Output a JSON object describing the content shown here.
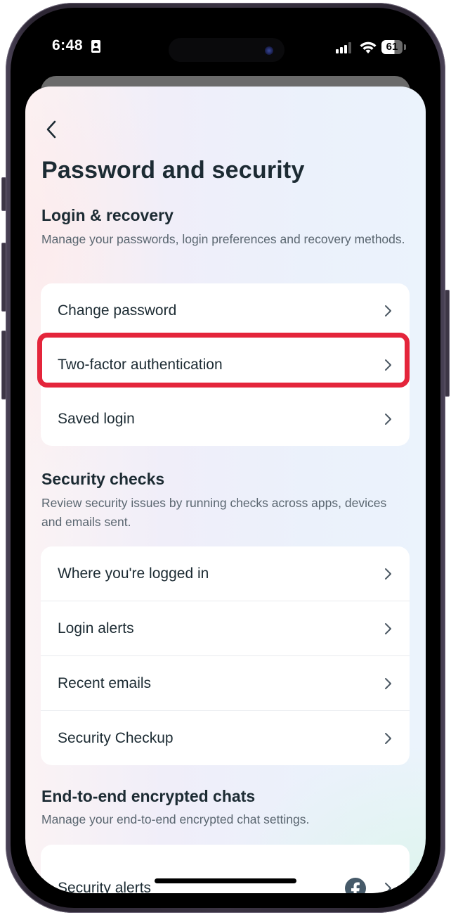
{
  "status_bar": {
    "time": "6:48",
    "battery_percent": "61",
    "icons": [
      "id-card-icon",
      "signal-icon",
      "wifi-icon",
      "battery-icon"
    ]
  },
  "header": {
    "back_icon": "chevron-left-icon",
    "title": "Password and security"
  },
  "sections": [
    {
      "title": "Login & recovery",
      "description": "Manage your passwords, login preferences and recovery methods.",
      "items": [
        {
          "label": "Change password",
          "icon": "chevron-right-icon"
        },
        {
          "label": "Two-factor authentication",
          "icon": "chevron-right-icon",
          "highlighted": true
        },
        {
          "label": "Saved login",
          "icon": "chevron-right-icon"
        }
      ]
    },
    {
      "title": "Security checks",
      "description": "Review security issues by running checks across apps, devices and emails sent.",
      "items": [
        {
          "label": "Where you're logged in",
          "icon": "chevron-right-icon"
        },
        {
          "label": "Login alerts",
          "icon": "chevron-right-icon"
        },
        {
          "label": "Recent emails",
          "icon": "chevron-right-icon"
        },
        {
          "label": "Security Checkup",
          "icon": "chevron-right-icon"
        }
      ]
    },
    {
      "title": "End-to-end encrypted chats",
      "description": "Manage your end-to-end encrypted chat settings.",
      "items": [
        {
          "label": "Security alerts",
          "icon": "chevron-right-icon",
          "badge_icon": "facebook-icon"
        }
      ]
    }
  ],
  "colors": {
    "highlight": "#e4253b",
    "text_primary": "#1c2b33",
    "text_secondary": "#5a6670",
    "facebook_icon": "#465a69"
  }
}
